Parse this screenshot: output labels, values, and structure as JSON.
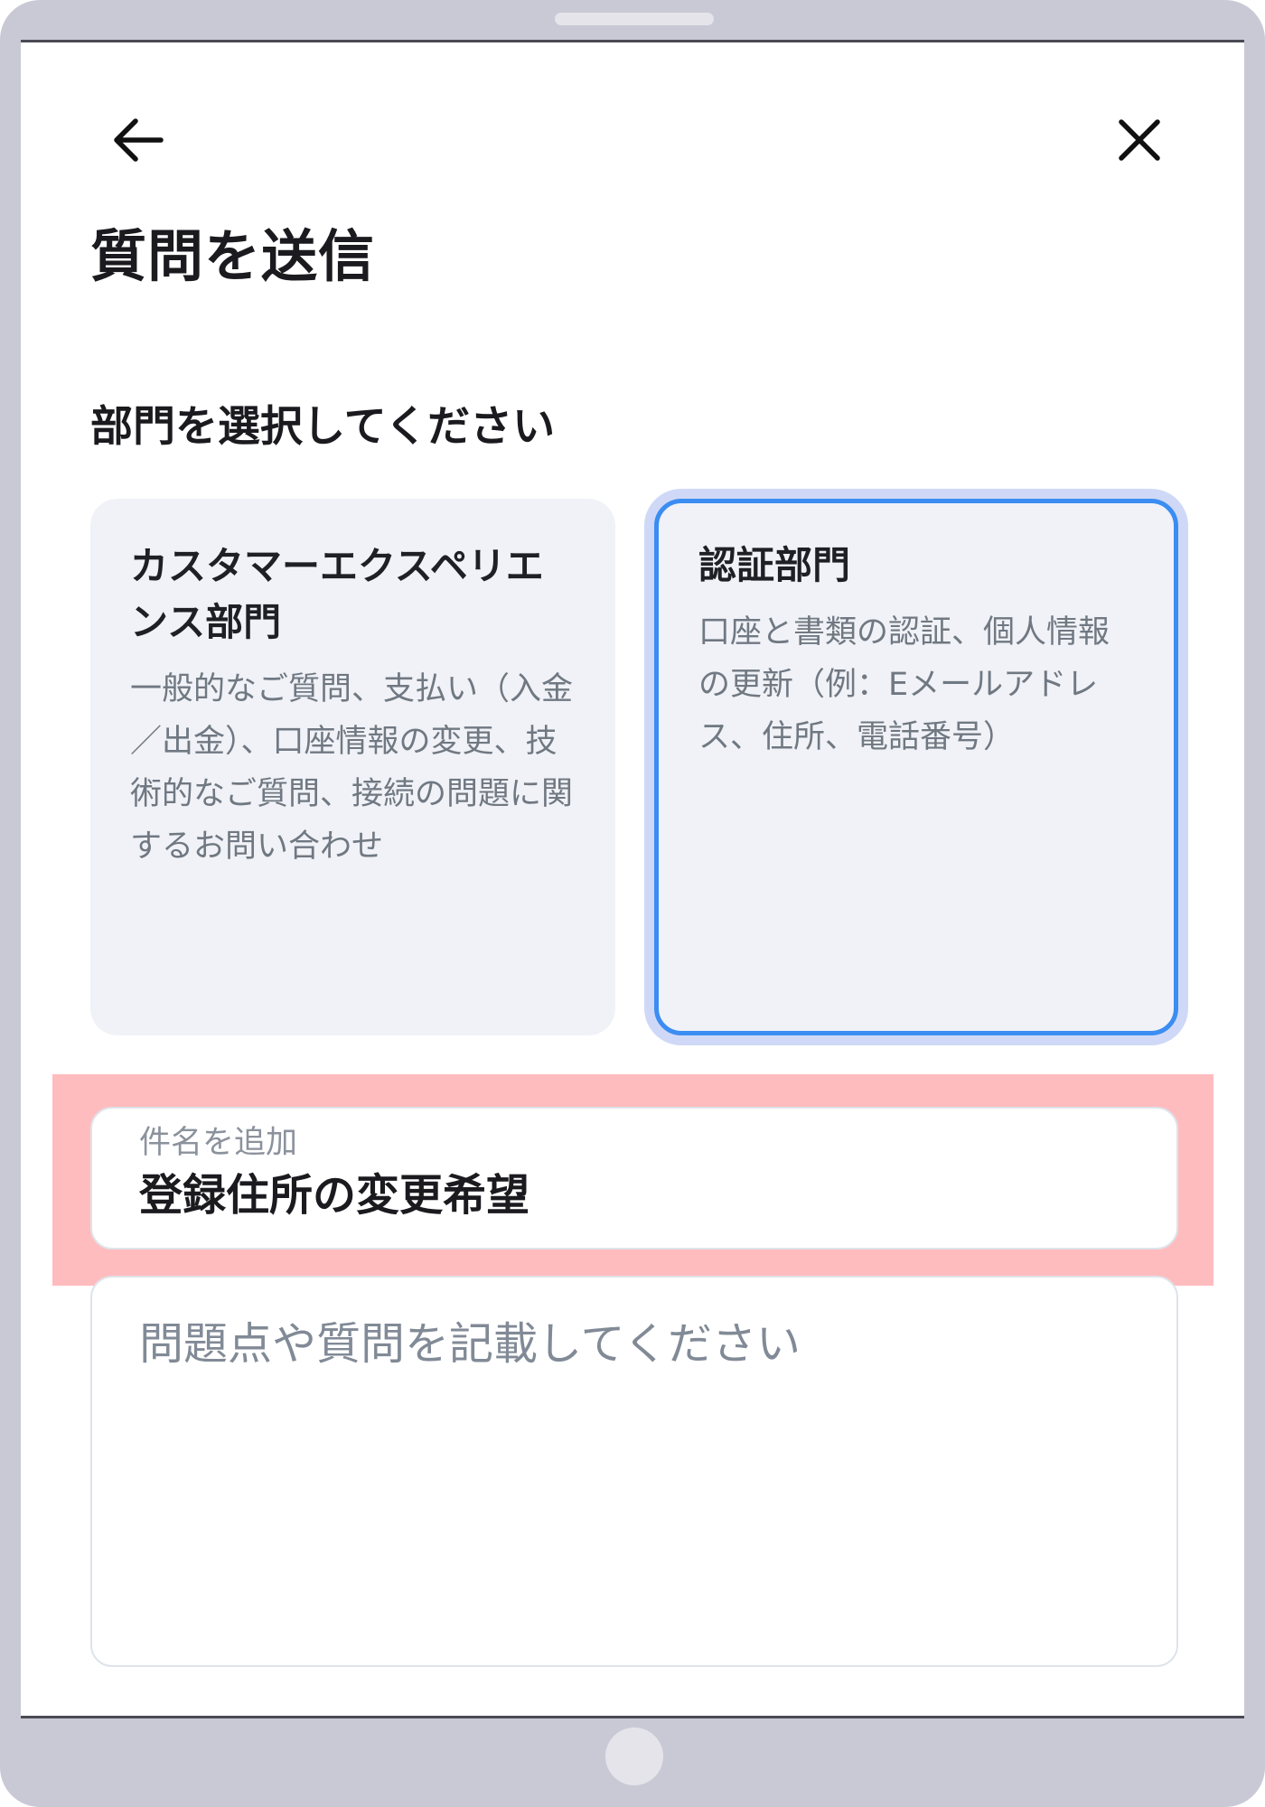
{
  "header": {
    "back_icon": "arrow-left-icon",
    "close_icon": "close-icon",
    "title": "質問を送信"
  },
  "department": {
    "label": "部門を選択してください",
    "options": [
      {
        "title": "カスタマーエクスペリエンス部門",
        "description": "一般的なご質問、支払い（入金／出金）、口座情報の変更、技術的なご質問、接続の問題に関するお問い合わせ",
        "selected": false
      },
      {
        "title": "認証部門",
        "description": "口座と書類の認証、個人情報の更新（例：Eメールアドレス、住所、電話番号）",
        "selected": true
      }
    ]
  },
  "form": {
    "subject_label": "件名を追加",
    "subject_value": "登録住所の変更希望",
    "message_placeholder": "問題点や質問を記載してください"
  },
  "colors": {
    "selected_border": "#3b8df2",
    "selected_glow": "#cfd9f7",
    "card_background": "#f0f2f7",
    "highlight": "#ffbcbe",
    "device_frame": "#c9c9d6"
  }
}
